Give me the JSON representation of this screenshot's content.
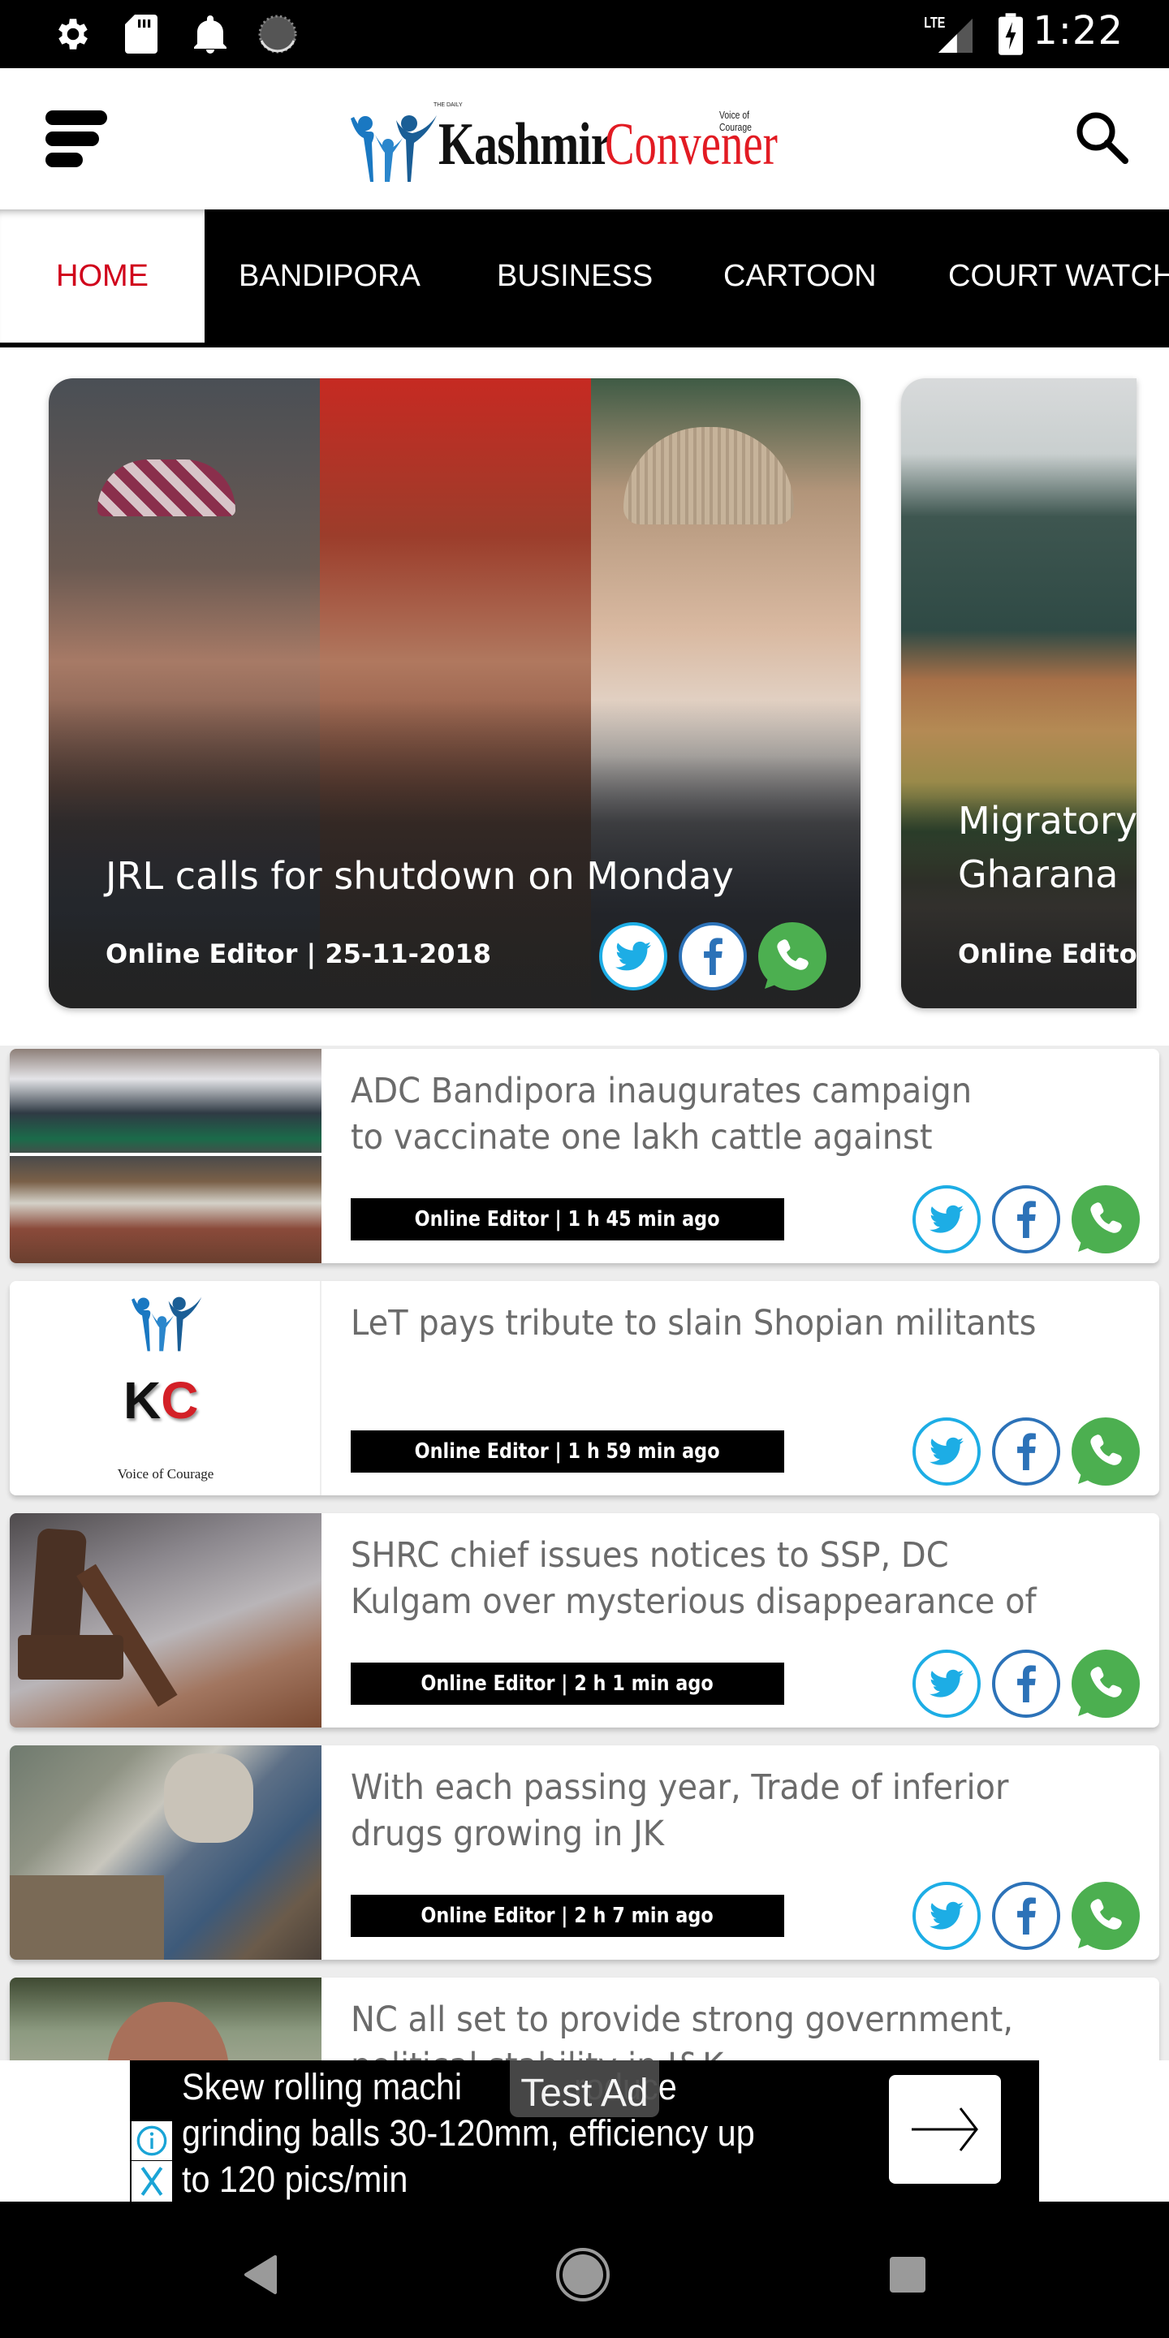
{
  "status_bar": {
    "left_icons": [
      "gear-icon",
      "sd-card-icon",
      "bell-icon",
      "sync-progress-icon"
    ],
    "network": "LTE",
    "time": "1:22"
  },
  "header": {
    "logo": {
      "small_text": "THE DAILY",
      "word1": "Kashmir",
      "word2": "Convener",
      "tagline": "Voice of Courage"
    },
    "brand_colors": {
      "red": "#e21b23",
      "black": "#111111",
      "blue": "#1a6fb5"
    }
  },
  "tabs": [
    {
      "label": "HOME",
      "active": true
    },
    {
      "label": "BANDIPORA",
      "active": false
    },
    {
      "label": "BUSINESS",
      "active": false
    },
    {
      "label": "CARTOON",
      "active": false
    },
    {
      "label": "COURT WATCH",
      "active": false
    }
  ],
  "hero_cards": [
    {
      "title": "JRL calls for shutdown on Monday",
      "meta": "Online Editor | 25-11-2018"
    },
    {
      "title_line1": "Migratory",
      "title_line2": "Gharana",
      "meta": "Online Editor |"
    }
  ],
  "articles": [
    {
      "title_line1": "ADC Bandipora inaugurates campaign",
      "title_line2": "to vaccinate one lakh cattle against",
      "meta": "Online Editor | 1 h 45 min ago"
    },
    {
      "title_line1": "LeT pays tribute to slain Shopian militants",
      "title_line2": "",
      "meta": "Online Editor | 1 h 59 min ago",
      "placeholder_logo": {
        "letters_k": "K",
        "letters_c": "C",
        "tagline": "Voice of Courage"
      }
    },
    {
      "title_line1": "SHRC chief issues notices to SSP, DC",
      "title_line2": "Kulgam over mysterious disappearance of",
      "meta": "Online Editor | 2 h 1 min ago"
    },
    {
      "title_line1": "With each passing year, Trade of inferior",
      "title_line2": "drugs growing in JK",
      "meta": "Online Editor | 2 h 7 min ago"
    },
    {
      "title_line1": "NC all set to provide strong government,",
      "title_line2": "political stability in J&K",
      "meta": ""
    }
  ],
  "social": {
    "twitter_color": "#1dade5",
    "facebook_color": "#2c72b8",
    "whatsapp_color": "#4caf50"
  },
  "ad": {
    "label": "Test Ad",
    "text": "Skew rolling machine produce grinding balls 30-120mm, efficiency up to 120 pics/min",
    "line1": "Skew rolling machi",
    "line1b": "roduce",
    "line2": "grinding balls 30-120mm, efficiency up",
    "line3": "to 120 pics/min"
  },
  "nav_bar": [
    "back",
    "home",
    "recents"
  ]
}
